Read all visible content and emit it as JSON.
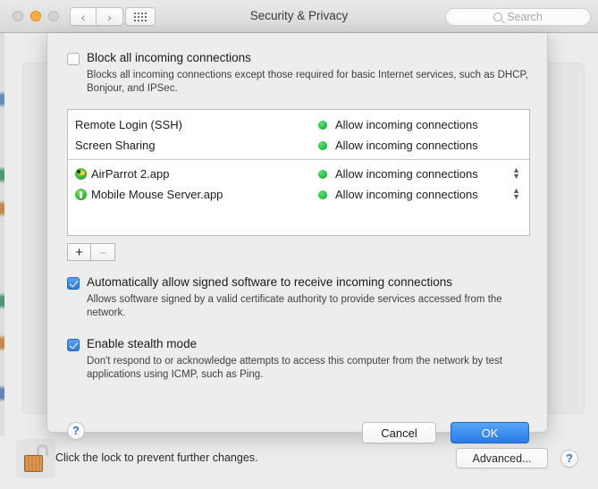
{
  "window": {
    "title": "Security & Privacy",
    "traffic_lights": [
      "close",
      "minimize",
      "zoom"
    ],
    "nav_back_icon": "chevron-left-icon",
    "nav_forward_icon": "chevron-right-icon",
    "show_all_icon": "grid-icon",
    "search": {
      "placeholder": "Search",
      "value": "",
      "icon": "search-icon"
    }
  },
  "sheet": {
    "block_all": {
      "checked": false,
      "label": "Block all incoming connections",
      "description": "Blocks all incoming connections except those required for basic Internet services,  such as DHCP, Bonjour, and IPSec."
    },
    "services": [
      {
        "name": "Remote Login (SSH)",
        "status": "Allow incoming connections",
        "status_color": "#22c442",
        "icon": null,
        "has_stepper": false
      },
      {
        "name": "Screen Sharing",
        "status": "Allow incoming connections",
        "status_color": "#22c442",
        "icon": null,
        "has_stepper": false
      }
    ],
    "apps": [
      {
        "name": "AirParrot 2.app",
        "status": "Allow incoming connections",
        "status_color": "#22c442",
        "icon": "airparrot-app-icon",
        "has_stepper": true
      },
      {
        "name": "Mobile Mouse Server.app",
        "status": "Allow incoming connections",
        "status_color": "#22c442",
        "icon": "mobile-mouse-app-icon",
        "has_stepper": true
      }
    ],
    "add_label": "+",
    "remove_label": "–",
    "auto_allow": {
      "checked": true,
      "label": "Automatically allow signed software to receive incoming connections",
      "description": "Allows software signed by a valid certificate authority to provide services accessed from the network."
    },
    "stealth": {
      "checked": true,
      "label": "Enable stealth mode",
      "description": "Don't respond to or acknowledge attempts to access this computer from the network by test applications using ICMP, such as Ping."
    },
    "help_label": "?",
    "cancel_label": "Cancel",
    "ok_label": "OK",
    "ok_accent": "#2b7ae8"
  },
  "footer": {
    "lock_icon": "padlock-open-icon",
    "lock_text": "Click the lock to prevent further changes.",
    "advanced_label": "Advanced...",
    "help_label": "?"
  }
}
